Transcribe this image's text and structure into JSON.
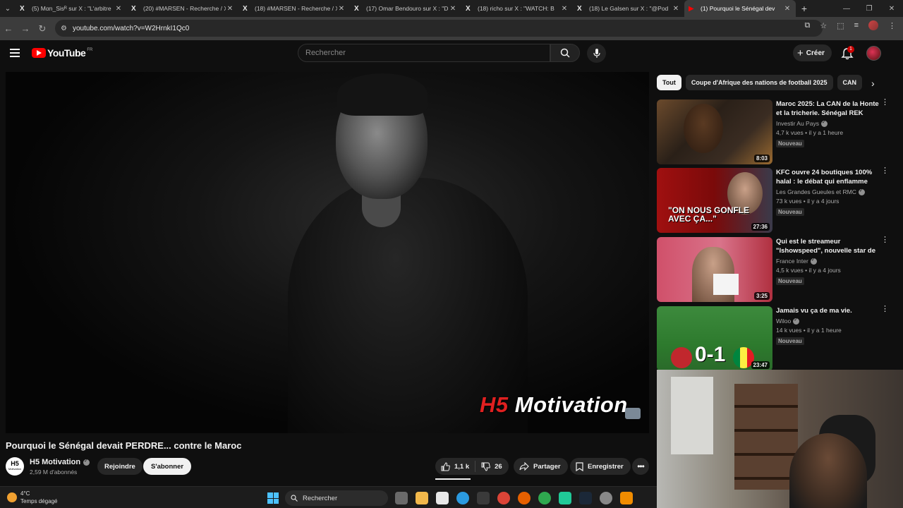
{
  "browser": {
    "tabs": [
      {
        "title": "(5) Mαn_Sisᴿ sur X : \"L'arbitre",
        "icon": "X"
      },
      {
        "title": "(20) #MARSEN - Recherche / X",
        "icon": "X"
      },
      {
        "title": "(18) #MARSEN - Recherche / X",
        "icon": "X"
      },
      {
        "title": "(17) Omar Bendouro sur X : \"D",
        "icon": "X"
      },
      {
        "title": "(18) richo sur X : \"WATCH: B",
        "icon": "X"
      },
      {
        "title": "(18) Le Galsen sur X : \"@Pod",
        "icon": "X"
      },
      {
        "title": "(1) Pourquoi le Sénégal dev",
        "icon": "▶",
        "active": true
      }
    ],
    "url": "youtube.com/watch?v=W2HrnkI1Qc0"
  },
  "youtube": {
    "logo_text": "YouTube",
    "region": "FR",
    "search_placeholder": "Rechercher",
    "create_label": "Créer",
    "notif_count": "1"
  },
  "video": {
    "watermark_prefix": "H5",
    "watermark_rest": " Motivation",
    "title": "Pourquoi le Sénégal devait PERDRE... contre le Maroc",
    "channel_logo": "H5",
    "channel_logo_sub": "Motivation",
    "channel_name": "H5 Motivation",
    "subscribers": "2,59 M d'abonnés",
    "join_label": "Rejoindre",
    "subscribe_label": "S'abonner",
    "likes": "1,1 k",
    "dislikes": "26",
    "share_label": "Partager",
    "save_label": "Enregistrer"
  },
  "chips": [
    "Tout",
    "Coupe d'Afrique des nations de football 2025",
    "CAN"
  ],
  "recommendations": [
    {
      "title": "Maroc 2025: La CAN de la Honte et la tricherie. Sénégal REK",
      "channel": "Investir Au Pays",
      "meta": "4,7 k vues • il y a 1 heure",
      "badge": "Nouveau",
      "duration": "8:03"
    },
    {
      "title": "KFC ouvre 24 boutiques 100% halal : le débat qui enflamme les...",
      "channel": "Les Grandes Gueules et RMC",
      "meta": "73 k vues • il y a 4 jours",
      "badge": "Nouveau",
      "duration": "27:36",
      "thumb_text": "\"ON NOUS GONFLE AVEC ÇA...\""
    },
    {
      "title": "Qui est le streameur \"Ishowspeed\", nouvelle star de ...",
      "channel": "France Inter",
      "meta": "4,5 k vues • il y a 4 jours",
      "badge": "Nouveau",
      "duration": "3:25"
    },
    {
      "title": "Jamais vu ça de ma vie.",
      "channel": "Wiloo",
      "meta": "14 k vues • il y a 1 heure",
      "badge": "Nouveau",
      "duration": "23:47",
      "thumb_text": "0-1"
    }
  ],
  "taskbar": {
    "temperature": "4°C",
    "weather": "Temps dégagé",
    "search_label": "Rechercher"
  },
  "colors": {
    "brand_red": "#ff0000",
    "background": "#0f0f0f",
    "chip_bg": "#272727"
  }
}
